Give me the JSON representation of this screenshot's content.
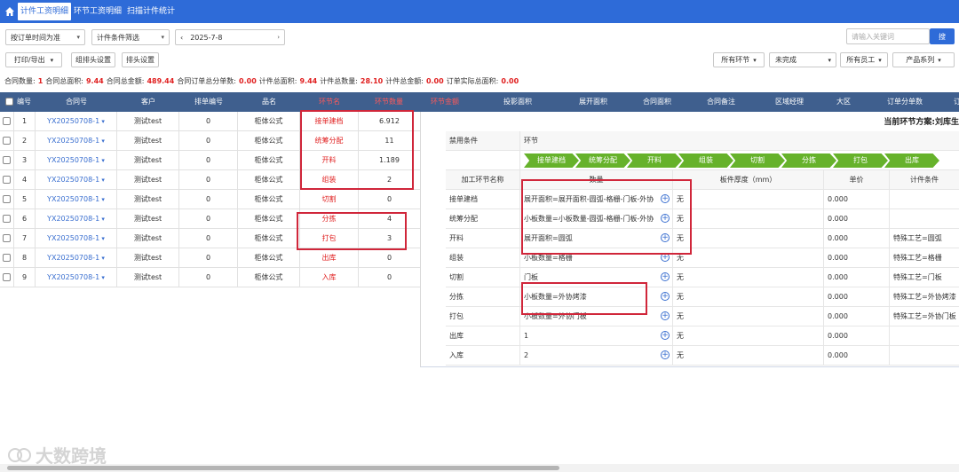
{
  "tabs": [
    {
      "label": "计件工资明细",
      "active": true
    },
    {
      "label": "环节工资明细",
      "active": false
    },
    {
      "label": "扫描计件统计",
      "active": false
    }
  ],
  "filters": {
    "time_mode": "按订单时间为准",
    "condition": "计件条件筛选",
    "date": "2025-7-8",
    "search_placeholder": "请输入关键词",
    "search_button": "搜"
  },
  "toolbar": {
    "print_export": "打印/导出",
    "group_header": "组排头设置",
    "header_setting": "排头设置",
    "all_steps": "所有环节",
    "status": "未完成",
    "all_staff": "所有员工",
    "product_series": "产品系列"
  },
  "summary": [
    {
      "label": "合同数量:",
      "value": "1"
    },
    {
      "label": "合同总面积:",
      "value": "9.44"
    },
    {
      "label": "合同总金额:",
      "value": "489.44"
    },
    {
      "label": "合同订单总分单数:",
      "value": "0.00"
    },
    {
      "label": "计件总面积:",
      "value": "9.44"
    },
    {
      "label": "计件总数量:",
      "value": "28.10"
    },
    {
      "label": "计件总金额:",
      "value": "0.00"
    },
    {
      "label": "订单实际总面积:",
      "value": "0.00"
    }
  ],
  "columns": [
    "编号",
    "合同号",
    "客户",
    "排单编号",
    "品名",
    "环节名",
    "环节数量",
    "环节金额",
    "投影面积",
    "展开面积",
    "合同面积",
    "合同备注",
    "区域经理",
    "大区",
    "订单分单数",
    "订单"
  ],
  "rows": [
    {
      "no": "1",
      "contract": "YX20250708-1",
      "customer": "测试test",
      "sched": "0",
      "product": "柜体公式",
      "step": "接单建档",
      "qty": "6.912"
    },
    {
      "no": "2",
      "contract": "YX20250708-1",
      "customer": "测试test",
      "sched": "0",
      "product": "柜体公式",
      "step": "统筹分配",
      "qty": "11"
    },
    {
      "no": "3",
      "contract": "YX20250708-1",
      "customer": "测试test",
      "sched": "0",
      "product": "柜体公式",
      "step": "开料",
      "qty": "1.189"
    },
    {
      "no": "4",
      "contract": "YX20250708-1",
      "customer": "测试test",
      "sched": "0",
      "product": "柜体公式",
      "step": "组装",
      "qty": "2"
    },
    {
      "no": "5",
      "contract": "YX20250708-1",
      "customer": "测试test",
      "sched": "0",
      "product": "柜体公式",
      "step": "切割",
      "qty": "0"
    },
    {
      "no": "6",
      "contract": "YX20250708-1",
      "customer": "测试test",
      "sched": "0",
      "product": "柜体公式",
      "step": "分拣",
      "qty": "4"
    },
    {
      "no": "7",
      "contract": "YX20250708-1",
      "customer": "测试test",
      "sched": "0",
      "product": "柜体公式",
      "step": "打包",
      "qty": "3"
    },
    {
      "no": "8",
      "contract": "YX20250708-1",
      "customer": "测试test",
      "sched": "0",
      "product": "柜体公式",
      "step": "出库",
      "qty": "0"
    },
    {
      "no": "9",
      "contract": "YX20250708-1",
      "customer": "测试test",
      "sched": "0",
      "product": "柜体公式",
      "step": "入库",
      "qty": "0"
    }
  ],
  "panel": {
    "title": "当前环节方案:刘库生",
    "disabled_label": "禁用条件",
    "step_label": "环节",
    "flow": [
      "接单建档",
      "统筹分配",
      "开料",
      "组装",
      "切割",
      "分拣",
      "打包",
      "出库"
    ],
    "headers": [
      "加工环节名称",
      "数量",
      "板件厚度（mm）",
      "单价",
      "计件条件"
    ],
    "rows": [
      {
        "name": "接单建档",
        "qty": "展开面积=展开面积-圆弧-格栅-门板-外协",
        "thick": "无",
        "price": "0.000",
        "cond": ""
      },
      {
        "name": "统筹分配",
        "qty": "小板数量=小板数量-圆弧-格栅-门板-外协",
        "thick": "无",
        "price": "0.000",
        "cond": ""
      },
      {
        "name": "开料",
        "qty": "展开面积=圆弧",
        "thick": "无",
        "price": "0.000",
        "cond": "特殊工艺=圆弧"
      },
      {
        "name": "组装",
        "qty": "小板数量=格栅",
        "thick": "无",
        "price": "0.000",
        "cond": "特殊工艺=格栅"
      },
      {
        "name": "切割",
        "qty": "门板",
        "thick": "无",
        "price": "0.000",
        "cond": "特殊工艺=门板"
      },
      {
        "name": "分拣",
        "qty": "小板数量=外协烤漆",
        "thick": "无",
        "price": "0.000",
        "cond": "特殊工艺=外协烤漆"
      },
      {
        "name": "打包",
        "qty": "小板数量=外协门板",
        "thick": "无",
        "price": "0.000",
        "cond": "特殊工艺=外协门板"
      },
      {
        "name": "出库",
        "qty": "1",
        "thick": "无",
        "price": "0.000",
        "cond": ""
      },
      {
        "name": "入库",
        "qty": "2",
        "thick": "无",
        "price": "0.000",
        "cond": ""
      }
    ]
  },
  "watermark": "大数跨境",
  "colors": {
    "header_blue": "#2e6bd8",
    "table_header": "#3f5f8e",
    "highlight": "#d0263a",
    "flow_green": "#66b22b"
  }
}
